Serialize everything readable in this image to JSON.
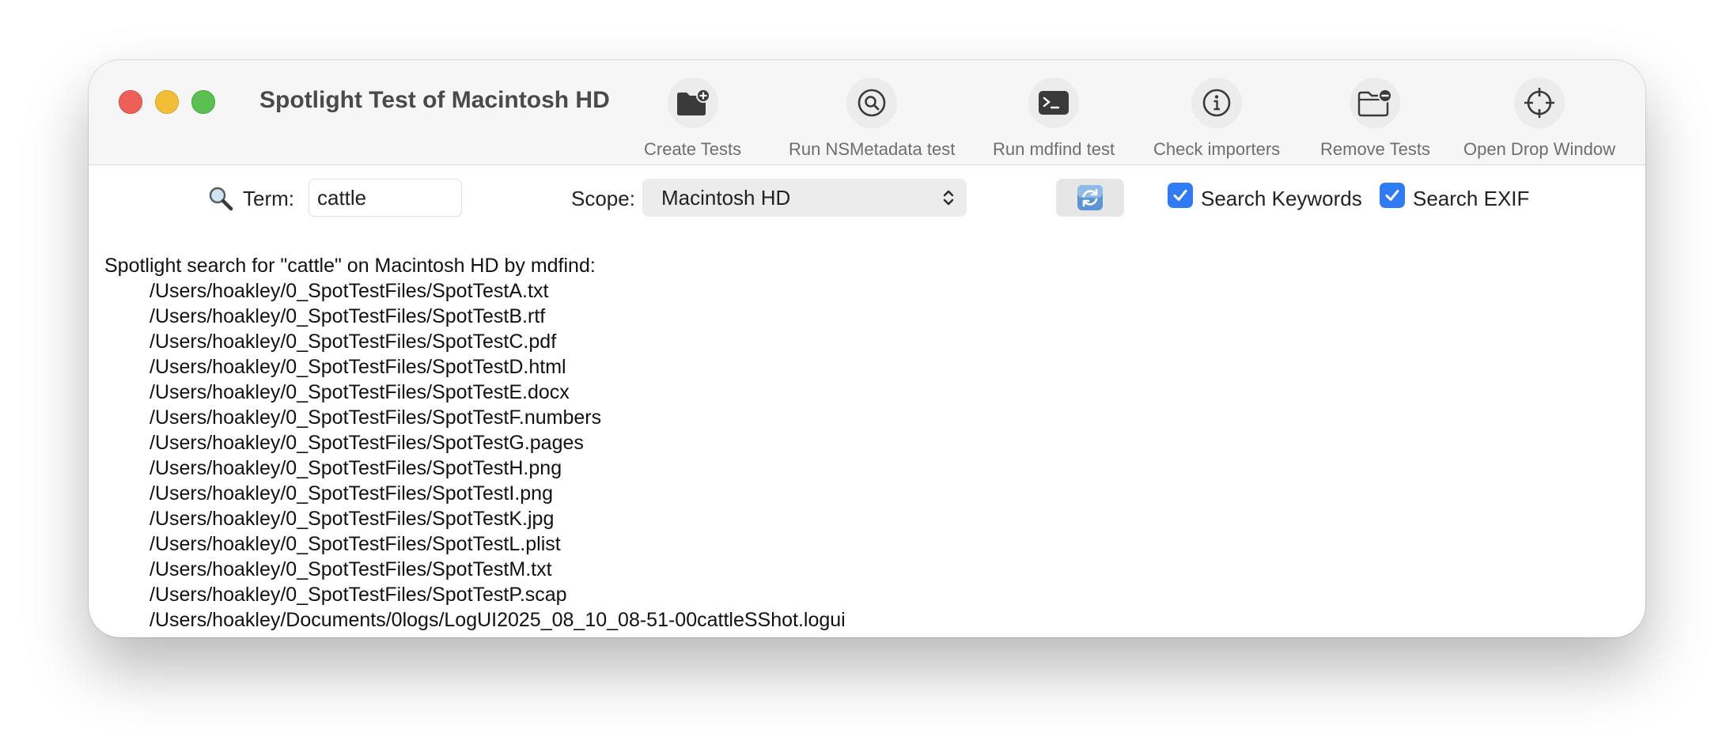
{
  "window": {
    "title": "Spotlight Test of Macintosh HD"
  },
  "toolbar": {
    "items": [
      {
        "label": "Create Tests",
        "icon": "folder-plus-icon"
      },
      {
        "label": "Run NSMetadata test",
        "icon": "magnifier-circle-icon"
      },
      {
        "label": "Run mdfind test",
        "icon": "terminal-icon"
      },
      {
        "label": "Check importers",
        "icon": "info-icon"
      },
      {
        "label": "Remove Tests",
        "icon": "folder-minus-icon"
      },
      {
        "label": "Open Drop Window",
        "icon": "crosshair-icon"
      }
    ]
  },
  "search": {
    "term_label": "Term:",
    "term_value": "cattle",
    "scope_label": "Scope:",
    "scope_value": "Macintosh HD",
    "keywords_label": "Search Keywords",
    "keywords_checked": true,
    "exif_label": "Search EXIF",
    "exif_checked": true
  },
  "output": {
    "heading": "Spotlight search for \"cattle\" on Macintosh HD by mdfind:",
    "lines": [
      "/Users/hoakley/0_SpotTestFiles/SpotTestA.txt",
      "/Users/hoakley/0_SpotTestFiles/SpotTestB.rtf",
      "/Users/hoakley/0_SpotTestFiles/SpotTestC.pdf",
      "/Users/hoakley/0_SpotTestFiles/SpotTestD.html",
      "/Users/hoakley/0_SpotTestFiles/SpotTestE.docx",
      "/Users/hoakley/0_SpotTestFiles/SpotTestF.numbers",
      "/Users/hoakley/0_SpotTestFiles/SpotTestG.pages",
      "/Users/hoakley/0_SpotTestFiles/SpotTestH.png",
      "/Users/hoakley/0_SpotTestFiles/SpotTestI.png",
      "/Users/hoakley/0_SpotTestFiles/SpotTestK.jpg",
      "/Users/hoakley/0_SpotTestFiles/SpotTestL.plist",
      "/Users/hoakley/0_SpotTestFiles/SpotTestM.txt",
      "/Users/hoakley/0_SpotTestFiles/SpotTestP.scap",
      "/Users/hoakley/Documents/0logs/LogUI2025_08_10_08-51-00cattleSShot.logui"
    ]
  },
  "colors": {
    "accent": "#2f7bf6",
    "close": "#ee5f57",
    "minimize": "#f4bd37",
    "maximize": "#5ac04f"
  }
}
